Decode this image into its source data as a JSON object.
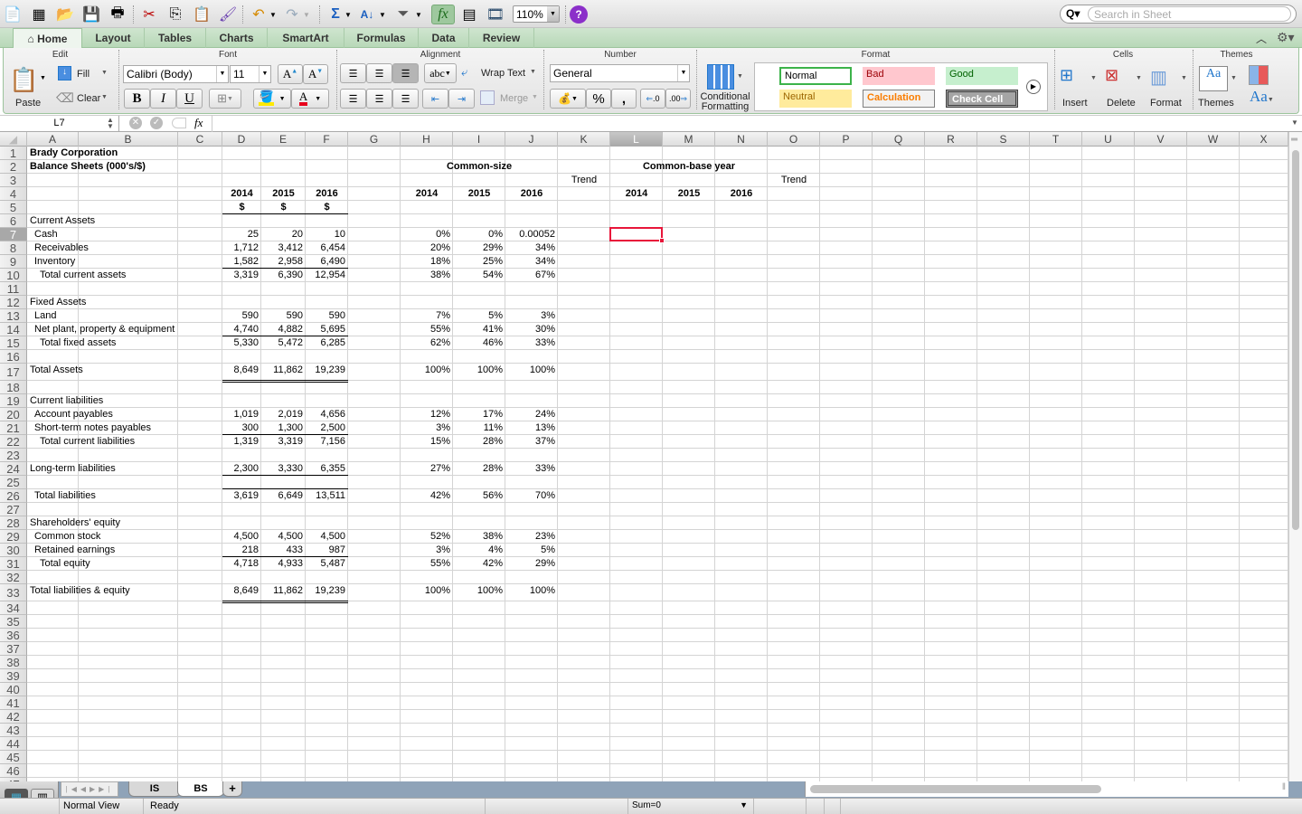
{
  "toolbar": {
    "zoom_level": "110%",
    "search_placeholder": "Search in Sheet"
  },
  "ribbon_tabs": [
    "Home",
    "Layout",
    "Tables",
    "Charts",
    "SmartArt",
    "Formulas",
    "Data",
    "Review"
  ],
  "active_tab": "Home",
  "ribbon": {
    "groups": {
      "edit": "Edit",
      "font": "Font",
      "alignment": "Alignment",
      "number": "Number",
      "format": "Format",
      "cells": "Cells",
      "themes": "Themes"
    },
    "paste": "Paste",
    "fill": "Fill",
    "clear": "Clear",
    "font_name": "Calibri (Body)",
    "font_size": "11",
    "bold": "B",
    "italic": "I",
    "underline": "U",
    "wrap_text": "Wrap Text",
    "merge": "Merge",
    "abc": "abc",
    "number_format": "General",
    "percent": "%",
    "comma": ",",
    "conditional_formatting_1": "Conditional",
    "conditional_formatting_2": "Formatting",
    "styles": {
      "normal": "Normal",
      "bad": "Bad",
      "good": "Good",
      "neutral": "Neutral",
      "calculation": "Calculation",
      "check_cell": "Check Cell"
    },
    "insert": "Insert",
    "delete": "Delete",
    "format": "Format",
    "themes": "Themes",
    "aa": "Aa"
  },
  "formula_bar": {
    "name_box": "L7",
    "fx": "fx",
    "formula": ""
  },
  "columns": [
    "A",
    "B",
    "C",
    "D",
    "E",
    "F",
    "G",
    "H",
    "I",
    "J",
    "K",
    "L",
    "M",
    "N",
    "O",
    "P",
    "Q",
    "R",
    "S",
    "T",
    "U",
    "V",
    "W",
    "X"
  ],
  "selected_cell": {
    "col": "L",
    "row": 7
  },
  "sheet": {
    "title": "Brady Corporation",
    "subtitle": "Balance Sheets (000's/$)",
    "common_size_header": "Common-size",
    "common_base_header": "Common-base year",
    "trend_label": "Trend",
    "years": [
      "2014",
      "2015",
      "2016"
    ],
    "currency": "$",
    "rows": [
      {
        "row": 6,
        "label": "Current Assets",
        "indent": 0,
        "values": [],
        "pct": []
      },
      {
        "row": 7,
        "label": "Cash",
        "indent": 1,
        "values": [
          "25",
          "20",
          "10"
        ],
        "pct": [
          "0%",
          "0%",
          "0.00052"
        ]
      },
      {
        "row": 8,
        "label": "Receivables",
        "indent": 1,
        "values": [
          "1,712",
          "3,412",
          "6,454"
        ],
        "pct": [
          "20%",
          "29%",
          "34%"
        ]
      },
      {
        "row": 9,
        "label": "Inventory",
        "indent": 1,
        "values": [
          "1,582",
          "2,958",
          "6,490"
        ],
        "pct": [
          "18%",
          "25%",
          "34%"
        ]
      },
      {
        "row": 10,
        "label": "Total current assets",
        "indent": 2,
        "values": [
          "3,319",
          "6,390",
          "12,954"
        ],
        "pct": [
          "38%",
          "54%",
          "67%"
        ]
      },
      {
        "row": 12,
        "label": "Fixed Assets",
        "indent": 0,
        "values": [],
        "pct": []
      },
      {
        "row": 13,
        "label": "Land",
        "indent": 1,
        "values": [
          "590",
          "590",
          "590"
        ],
        "pct": [
          "7%",
          "5%",
          "3%"
        ]
      },
      {
        "row": 14,
        "label": "Net plant, property & equipment",
        "indent": 1,
        "values": [
          "4,740",
          "4,882",
          "5,695"
        ],
        "pct": [
          "55%",
          "41%",
          "30%"
        ]
      },
      {
        "row": 15,
        "label": "Total fixed assets",
        "indent": 2,
        "values": [
          "5,330",
          "5,472",
          "6,285"
        ],
        "pct": [
          "62%",
          "46%",
          "33%"
        ]
      },
      {
        "row": 17,
        "label": "Total Assets",
        "indent": 0,
        "values": [
          "8,649",
          "11,862",
          "19,239"
        ],
        "pct": [
          "100%",
          "100%",
          "100%"
        ]
      },
      {
        "row": 19,
        "label": "Current liabilities",
        "indent": 0,
        "values": [],
        "pct": []
      },
      {
        "row": 20,
        "label": "Account payables",
        "indent": 1,
        "values": [
          "1,019",
          "2,019",
          "4,656"
        ],
        "pct": [
          "12%",
          "17%",
          "24%"
        ]
      },
      {
        "row": 21,
        "label": "Short-term notes payables",
        "indent": 1,
        "values": [
          "300",
          "1,300",
          "2,500"
        ],
        "pct": [
          "3%",
          "11%",
          "13%"
        ]
      },
      {
        "row": 22,
        "label": "Total current liabilities",
        "indent": 2,
        "values": [
          "1,319",
          "3,319",
          "7,156"
        ],
        "pct": [
          "15%",
          "28%",
          "37%"
        ]
      },
      {
        "row": 24,
        "label": "Long-term liabilities",
        "indent": 0,
        "values": [
          "2,300",
          "3,330",
          "6,355"
        ],
        "pct": [
          "27%",
          "28%",
          "33%"
        ]
      },
      {
        "row": 26,
        "label": "Total liabilities",
        "indent": 1,
        "values": [
          "3,619",
          "6,649",
          "13,511"
        ],
        "pct": [
          "42%",
          "56%",
          "70%"
        ]
      },
      {
        "row": 28,
        "label": "Shareholders' equity",
        "indent": 0,
        "values": [],
        "pct": []
      },
      {
        "row": 29,
        "label": "Common stock",
        "indent": 1,
        "values": [
          "4,500",
          "4,500",
          "4,500"
        ],
        "pct": [
          "52%",
          "38%",
          "23%"
        ]
      },
      {
        "row": 30,
        "label": "Retained earnings",
        "indent": 1,
        "values": [
          "218",
          "433",
          "987"
        ],
        "pct": [
          "3%",
          "4%",
          "5%"
        ]
      },
      {
        "row": 31,
        "label": "Total equity",
        "indent": 2,
        "values": [
          "4,718",
          "4,933",
          "5,487"
        ],
        "pct": [
          "55%",
          "42%",
          "29%"
        ]
      },
      {
        "row": 33,
        "label": "Total liabilities & equity",
        "indent": 0,
        "values": [
          "8,649",
          "11,862",
          "19,239"
        ],
        "pct": [
          "100%",
          "100%",
          "100%"
        ]
      }
    ]
  },
  "sheet_tabs": [
    {
      "name": "IS",
      "active": false
    },
    {
      "name": "BS",
      "active": true
    }
  ],
  "add_sheet": "+",
  "status": {
    "view": "Normal View",
    "state": "Ready",
    "sum": "Sum=0"
  },
  "colors": {
    "accent_green": "#b8d8b8",
    "selection_red": "#e8163a",
    "tabs_bg": "#8fa3b8"
  }
}
